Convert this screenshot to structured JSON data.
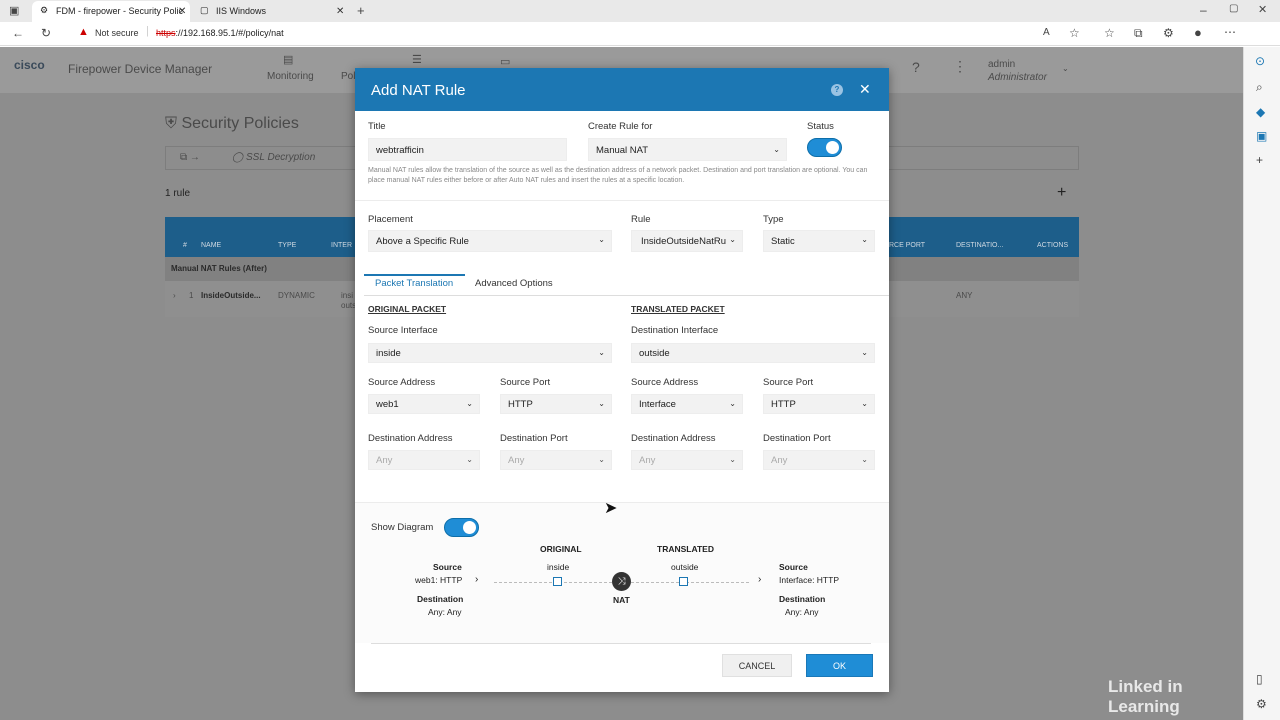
{
  "browser": {
    "tabs": [
      {
        "title": "FDM - firepower - Security Polic"
      },
      {
        "title": "IIS Windows"
      }
    ],
    "security_label": "Not secure",
    "url_scheme": "https",
    "url_rest": "://192.168.95.1/#/policy/nat"
  },
  "app": {
    "brand": "cisco",
    "product": "Firepower Device Manager",
    "nav": [
      "Monitoring",
      "Poli"
    ],
    "user_name": "admin",
    "user_role": "Administrator",
    "page_title": "Security Policies",
    "breadcrumb": [
      "SSL Decryption"
    ],
    "rule_count": "1 rule",
    "table_headers": [
      "#",
      "NAME",
      "TYPE",
      "INTER",
      "RCE PORT",
      "DESTINATIO...",
      "ACTIONS"
    ],
    "section_label": "Manual NAT Rules (After)",
    "row": {
      "num": "1",
      "name": "InsideOutside...",
      "type": "DYNAMIC",
      "iface1": "insi",
      "iface2": "outs",
      "dest": "ANY"
    }
  },
  "modal": {
    "title": "Add NAT Rule",
    "fields": {
      "title_label": "Title",
      "title_value": "webtrafficin",
      "create_label": "Create Rule for",
      "create_value": "Manual NAT",
      "status_label": "Status",
      "help_text": "Manual NAT rules allow the translation of the source as well as the destination address of a network packet. Destination and port translation are optional. You can place manual NAT rules either before or after Auto NAT rules and insert the rules at a specific location.",
      "placement_label": "Placement",
      "placement_value": "Above a Specific Rule",
      "rule_label": "Rule",
      "rule_value": "InsideOutsideNatRu",
      "type_label": "Type",
      "type_value": "Static"
    },
    "tabs": [
      "Packet Translation",
      "Advanced Options"
    ],
    "original": {
      "header": "ORIGINAL PACKET",
      "src_iface_label": "Source Interface",
      "src_iface": "inside",
      "src_addr_label": "Source Address",
      "src_addr": "web1",
      "src_port_label": "Source Port",
      "src_port": "HTTP",
      "dst_addr_label": "Destination Address",
      "dst_addr": "Any",
      "dst_port_label": "Destination Port",
      "dst_port": "Any"
    },
    "translated": {
      "header": "TRANSLATED PACKET",
      "dst_iface_label": "Destination Interface",
      "dst_iface": "outside",
      "src_addr_label": "Source Address",
      "src_addr": "Interface",
      "src_port_label": "Source Port",
      "src_port": "HTTP",
      "dst_addr_label": "Destination Address",
      "dst_addr": "Any",
      "dst_port_label": "Destination Port",
      "dst_port": "Any"
    },
    "diagram": {
      "toggle_label": "Show Diagram",
      "original_label": "ORIGINAL",
      "translated_label": "TRANSLATED",
      "left_source_label": "Source",
      "left_source_value": "web1: HTTP",
      "left_dest_label": "Destination",
      "left_dest_value": "Any: Any",
      "inside_label": "inside",
      "outside_label": "outside",
      "nat_label": "NAT",
      "right_source_label": "Source",
      "right_source_value": "Interface: HTTP",
      "right_dest_label": "Destination",
      "right_dest_value": "Any: Any"
    },
    "cancel_label": "CANCEL",
    "ok_label": "OK"
  },
  "watermark": "Linked in Learning",
  "colors": {
    "accent": "#1c77b3",
    "toggle": "#1f8dd6",
    "table_header": "#1d5e8a"
  }
}
